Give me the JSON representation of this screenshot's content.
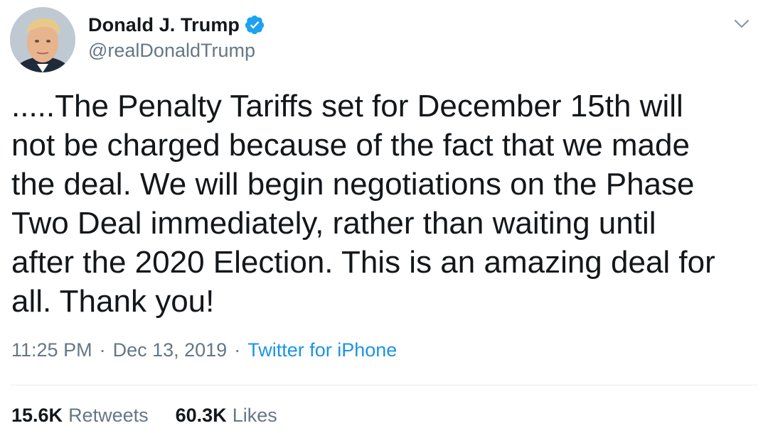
{
  "author": {
    "display_name": "Donald J. Trump",
    "handle": "@realDonaldTrump",
    "verified": true,
    "avatar_icon": "profile-photo-icon"
  },
  "tweet": {
    "text": ".....The Penalty Tariffs set for December 15th will\nnot be charged because of the fact that we made\nthe deal. We will begin negotiations on the Phase\nTwo Deal immediately, rather than waiting until\nafter the 2020 Election. This is an amazing deal for\nall. Thank you!"
  },
  "meta": {
    "time": "11:25 PM",
    "separator": "·",
    "date": "Dec 13, 2019",
    "source": "Twitter for iPhone"
  },
  "stats": {
    "retweets_count": "15.6K",
    "retweets_label": "Retweets",
    "likes_count": "60.3K",
    "likes_label": "Likes"
  },
  "colors": {
    "text": "#14171a",
    "secondary": "#657786",
    "link": "#1b95e0",
    "verified": "#1da1f2",
    "divider": "#e6ecf0"
  },
  "icons": {
    "verified": "verified-badge-icon",
    "menu": "chevron-down-icon"
  }
}
